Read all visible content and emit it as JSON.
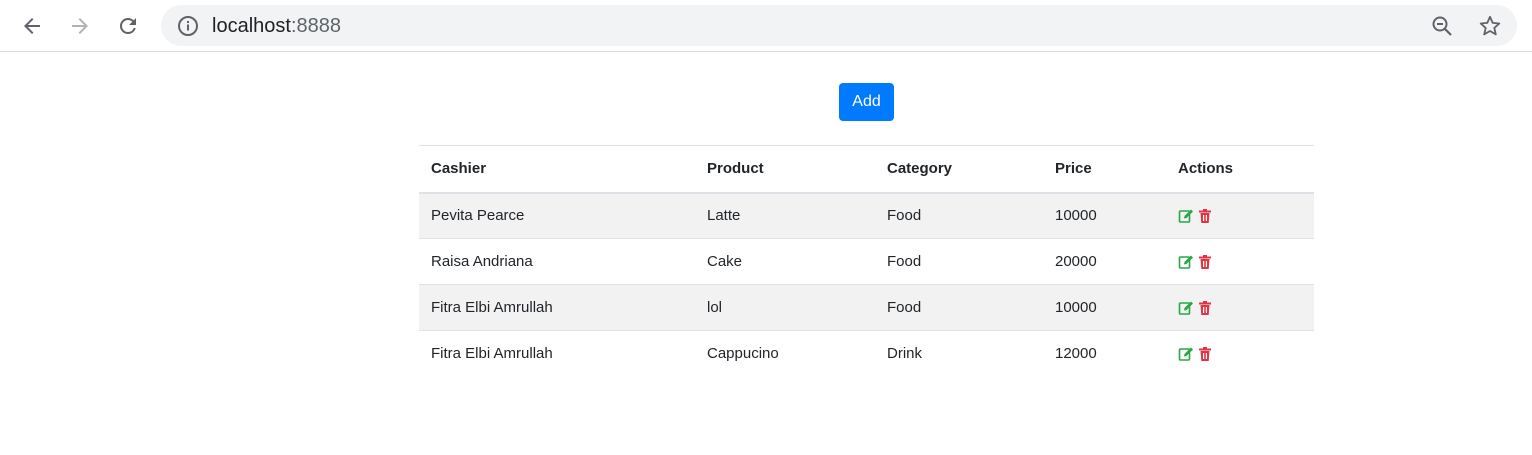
{
  "browser": {
    "url_host": "localhost",
    "url_port": ":8888",
    "icons": [
      "back-arrow-icon",
      "forward-arrow-icon",
      "reload-icon",
      "info-icon",
      "zoom-out-icon",
      "star-icon"
    ]
  },
  "page": {
    "add_label": "Add",
    "add_color": "#007bff"
  },
  "table": {
    "headers": [
      "Cashier",
      "Product",
      "Category",
      "Price",
      "Actions"
    ],
    "rows": [
      {
        "cashier": "Pevita Pearce",
        "product": "Latte",
        "category": "Food",
        "price": "10000"
      },
      {
        "cashier": "Raisa Andriana",
        "product": "Cake",
        "category": "Food",
        "price": "20000"
      },
      {
        "cashier": "Fitra Elbi Amrullah",
        "product": "lol",
        "category": "Food",
        "price": "10000"
      },
      {
        "cashier": "Fitra Elbi Amrullah",
        "product": "Cappucino",
        "category": "Drink",
        "price": "12000"
      }
    ],
    "action_icons": [
      "edit-icon",
      "delete-icon"
    ],
    "edit_color": "#28a745",
    "delete_color": "#dc3545"
  }
}
